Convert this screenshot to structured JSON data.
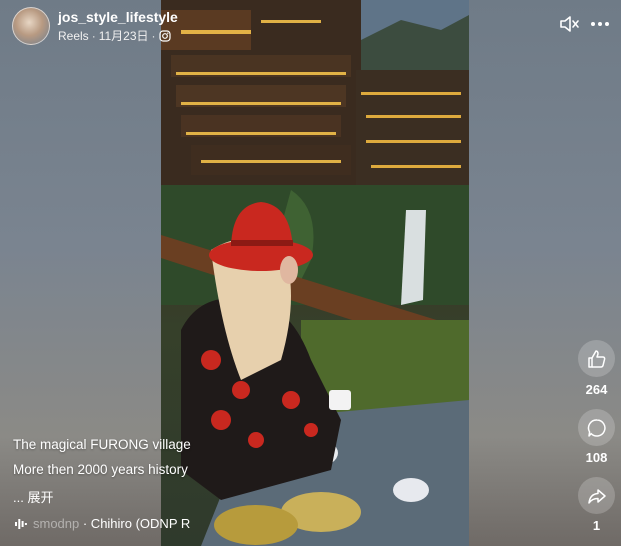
{
  "post": {
    "username": "jos_style_lifestyle",
    "source": "Reels",
    "date": "11月23日",
    "separator": "·",
    "privacy_icon": "instagram-icon"
  },
  "controls": {
    "mute_icon": "speaker-muted-icon",
    "more_icon": "more-horizontal-icon"
  },
  "actions": {
    "like_count": "264",
    "comment_count": "108",
    "share_count": "1"
  },
  "caption": {
    "line1": "The magical FURONG village",
    "line2": "More then 2000 years history",
    "expand_label": "... 展开"
  },
  "audio": {
    "faded_prefix": "smodnp",
    "text": " · Chihiro (ODNP R"
  },
  "colors": {
    "hat": "#c9281f",
    "jacket": "#b0201a",
    "lights": "#f2c04a"
  }
}
